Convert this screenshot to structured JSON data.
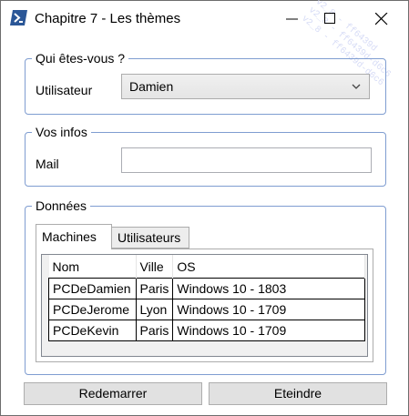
{
  "window": {
    "title": "Chapitre 7 - Les thèmes",
    "watermark_lines": [
      "v2_8 - ff6439d",
      "v2_8 - ff6439d-d6c6",
      "v2_8 - ff6439d-d6c6"
    ]
  },
  "identity": {
    "legend": "Qui êtes-vous ?",
    "user_label": "Utilisateur",
    "user_value": "Damien"
  },
  "info": {
    "legend": "Vos infos",
    "mail_label": "Mail",
    "mail_value": ""
  },
  "data": {
    "legend": "Données",
    "tabs": [
      {
        "label": "Machines",
        "selected": true
      },
      {
        "label": "Utilisateurs",
        "selected": false
      }
    ],
    "grid": {
      "columns": [
        "Nom",
        "Ville",
        "OS"
      ],
      "rows": [
        {
          "nom": "PCDeDamien",
          "ville": "Paris",
          "os": "Windows 10 - 1803"
        },
        {
          "nom": "PCDeJerome",
          "ville": "Lyon",
          "os": "Windows 10 - 1709"
        },
        {
          "nom": "PCDeKevin",
          "ville": "Paris",
          "os": "Windows 10 - 1709"
        }
      ]
    }
  },
  "actions": {
    "restart_label": "Redemarrer",
    "shutdown_label": "Eteindre"
  },
  "colors": {
    "group_border": "#7f9dd1",
    "app_icon": "#2b5797",
    "button_face": "#e1e1e1"
  }
}
